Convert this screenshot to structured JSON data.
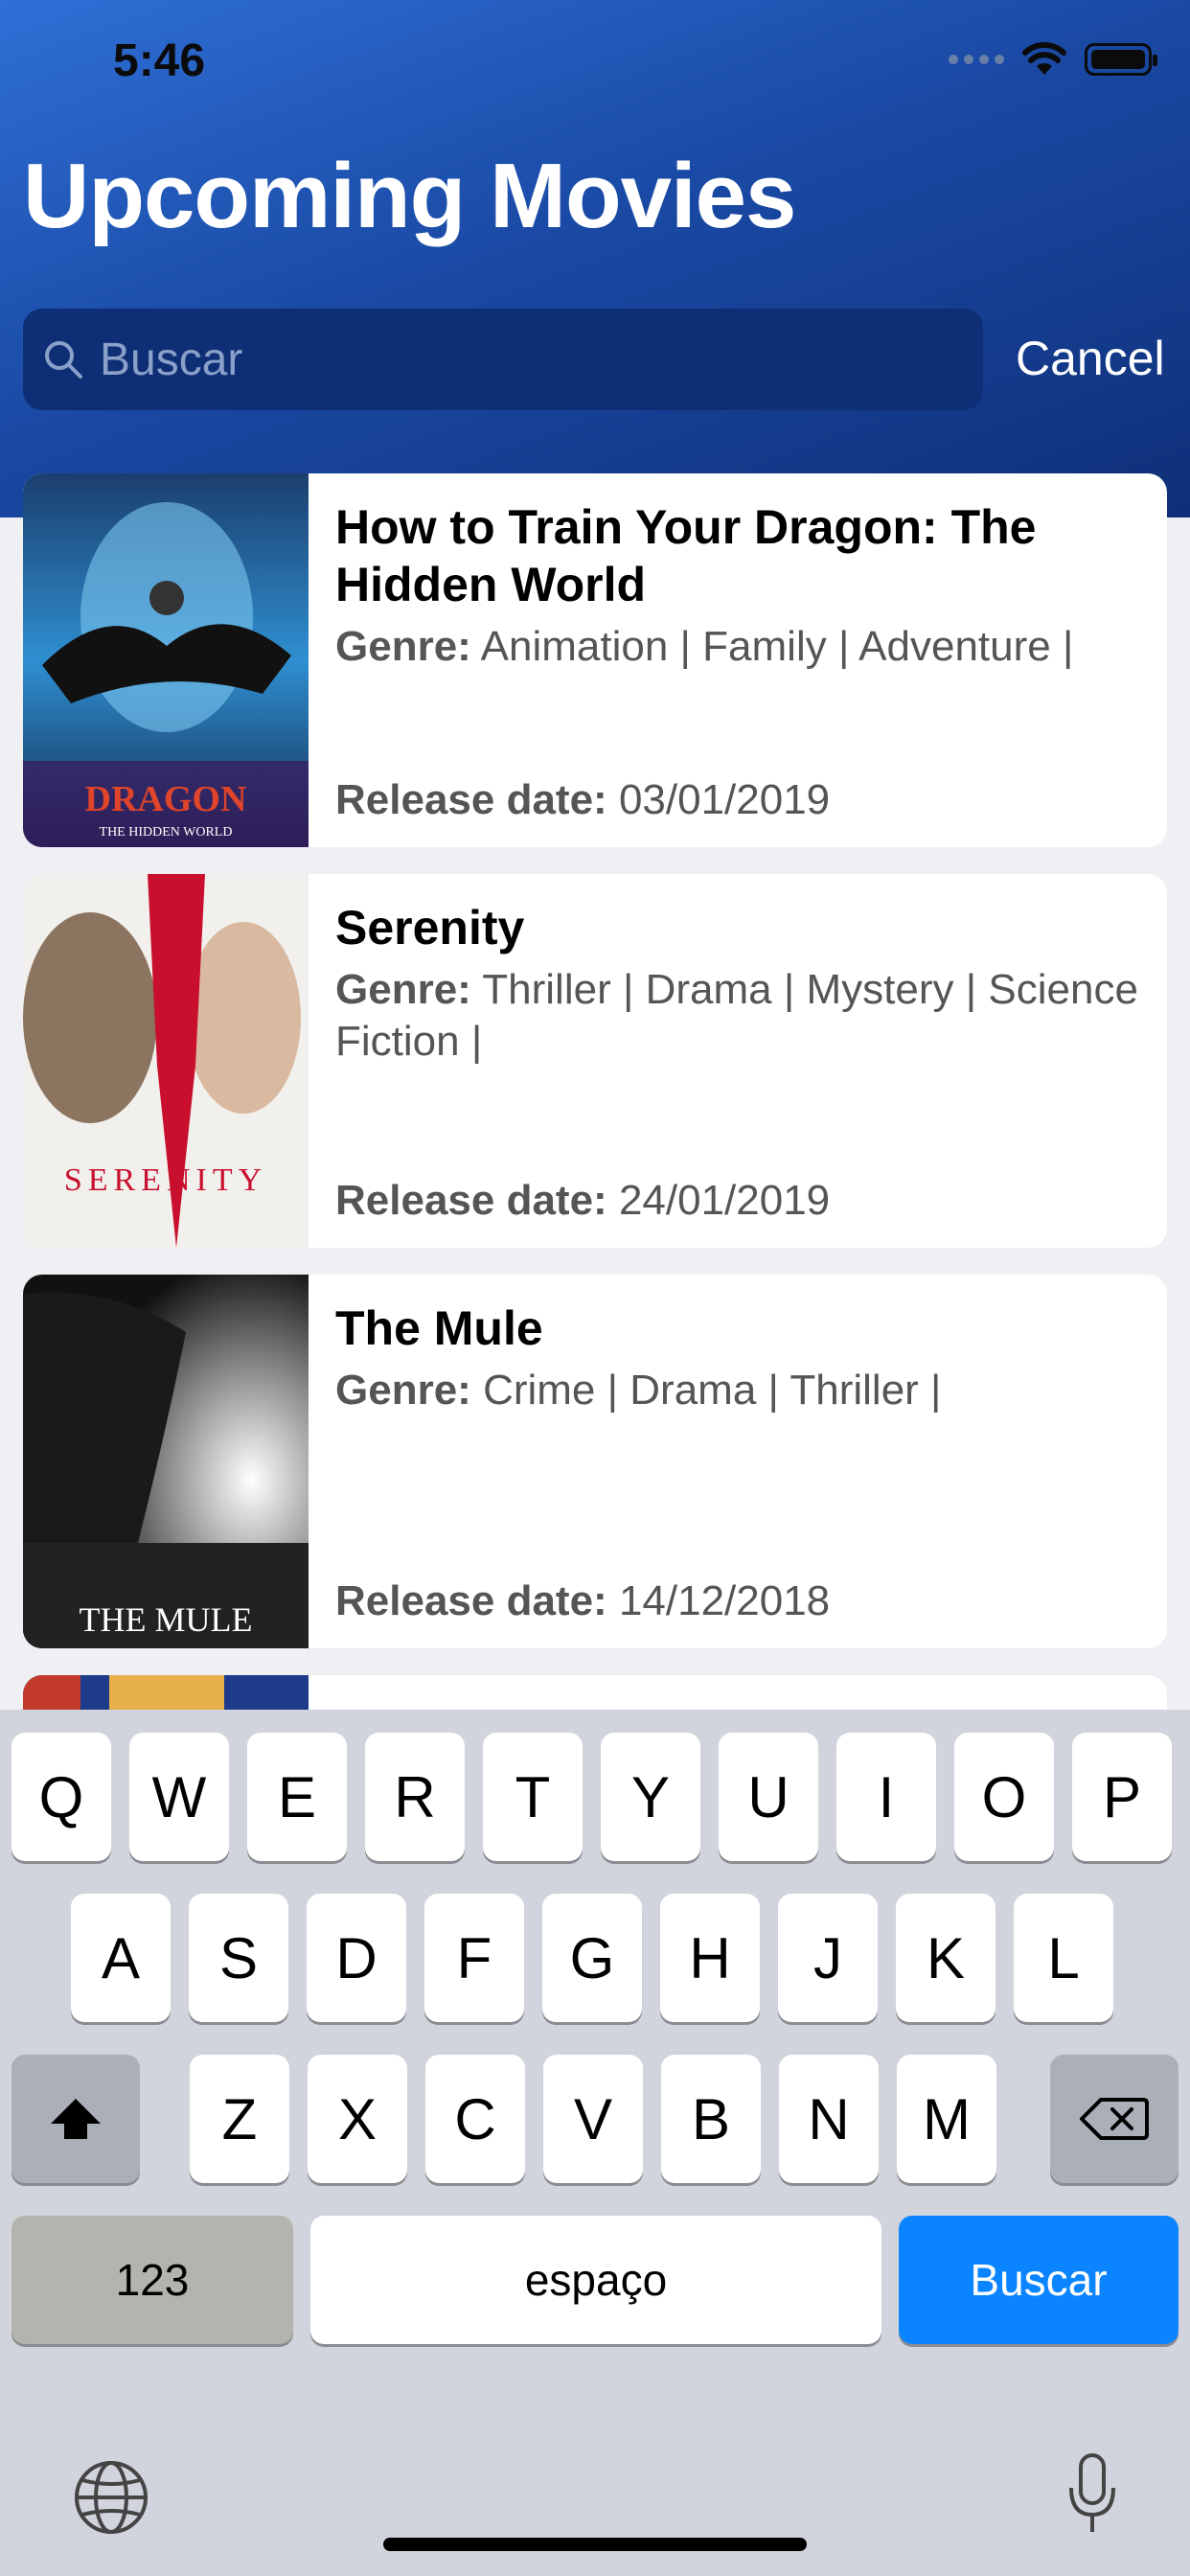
{
  "status": {
    "time": "5:46"
  },
  "header": {
    "title": "Upcoming Movies",
    "search_placeholder": "Buscar",
    "cancel_label": "Cancel"
  },
  "labels": {
    "genre": "Genre:",
    "release": "Release date:"
  },
  "movies": [
    {
      "title": "How to Train Your Dragon: The Hidden World",
      "genres": "Animation | Family | Adventure |",
      "release": "03/01/2019",
      "poster_text": "DRAGON",
      "poster_subtext": "THE HIDDEN WORLD"
    },
    {
      "title": "Serenity",
      "genres": "Thriller | Drama | Mystery | Science Fiction |",
      "release": "24/01/2019",
      "poster_text": "SERENITY"
    },
    {
      "title": "The Mule",
      "genres": "Crime | Drama | Thriller |",
      "release": "14/12/2018",
      "poster_text": "THE MULE"
    }
  ],
  "keyboard": {
    "row1": [
      "Q",
      "W",
      "E",
      "R",
      "T",
      "Y",
      "U",
      "I",
      "O",
      "P"
    ],
    "row2": [
      "A",
      "S",
      "D",
      "F",
      "G",
      "H",
      "J",
      "K",
      "L"
    ],
    "row3": [
      "Z",
      "X",
      "C",
      "V",
      "B",
      "N",
      "M"
    ],
    "numbers_label": "123",
    "space_label": "espaço",
    "return_label": "Buscar"
  },
  "icons": [
    "search-icon",
    "wifi-icon",
    "battery-icon",
    "shift-icon",
    "backspace-icon",
    "globe-icon",
    "microphone-icon"
  ]
}
